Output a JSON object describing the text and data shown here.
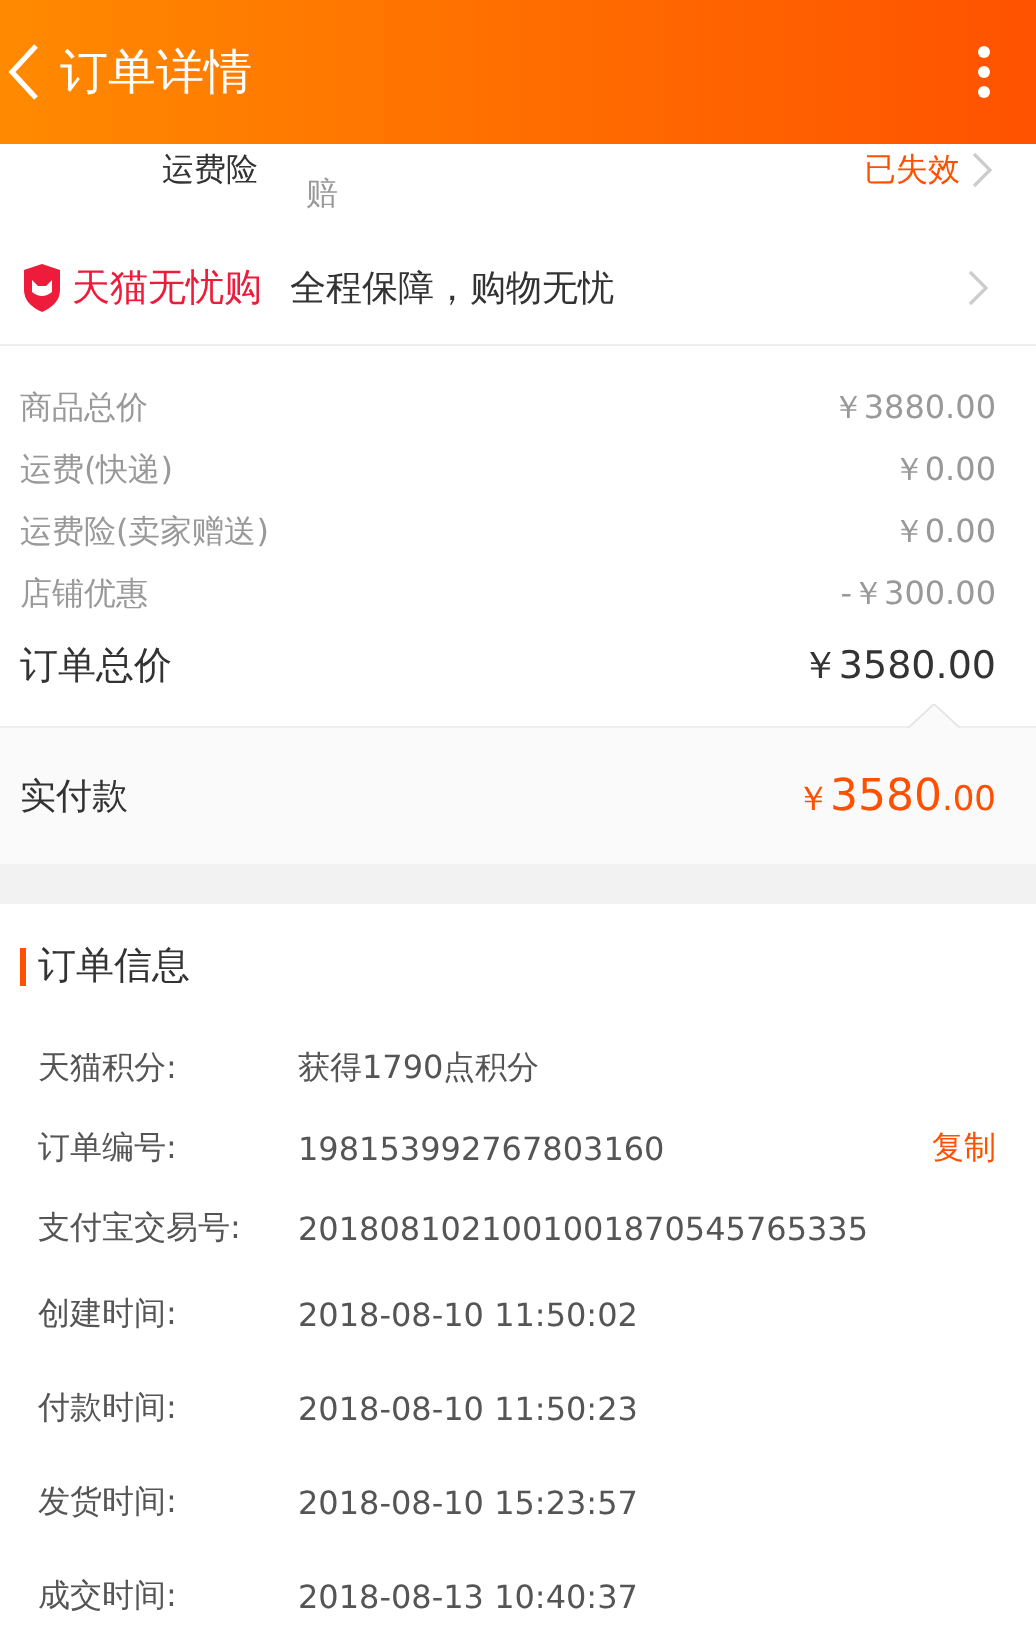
{
  "header": {
    "title": "订单详情"
  },
  "insurance_row": {
    "label": "运费险",
    "note": "赔",
    "status": "已失效"
  },
  "guarantee": {
    "brand": "天猫无忧购",
    "text": "全程保障，购物无忧"
  },
  "price_rows": [
    {
      "label": "商品总价",
      "value": "￥3880.00"
    },
    {
      "label": "运费(快递)",
      "value": "￥0.00"
    },
    {
      "label": "运费险(卖家赠送)",
      "value": "￥0.00"
    },
    {
      "label": "店铺优惠",
      "value": "-￥300.00"
    }
  ],
  "order_total": {
    "label": "订单总价",
    "value": "￥3580.00"
  },
  "paid": {
    "label": "实付款",
    "currency": "￥",
    "amount": "3580",
    "cents": ".00"
  },
  "order_info": {
    "title": "订单信息",
    "rows": [
      {
        "label": "天猫积分:",
        "value": "获得1790点积分"
      },
      {
        "label": "订单编号:",
        "value": "198153992767803160",
        "action": "复制"
      },
      {
        "label": "支付宝交易号:",
        "value": "2018081021001001870545765335"
      },
      {
        "label": "创建时间:",
        "value": "2018-08-10 11:50:02"
      },
      {
        "label": "付款时间:",
        "value": "2018-08-10 11:50:23"
      },
      {
        "label": "发货时间:",
        "value": "2018-08-10 15:23:57"
      },
      {
        "label": "成交时间:",
        "value": "2018-08-13 10:40:37"
      }
    ]
  }
}
